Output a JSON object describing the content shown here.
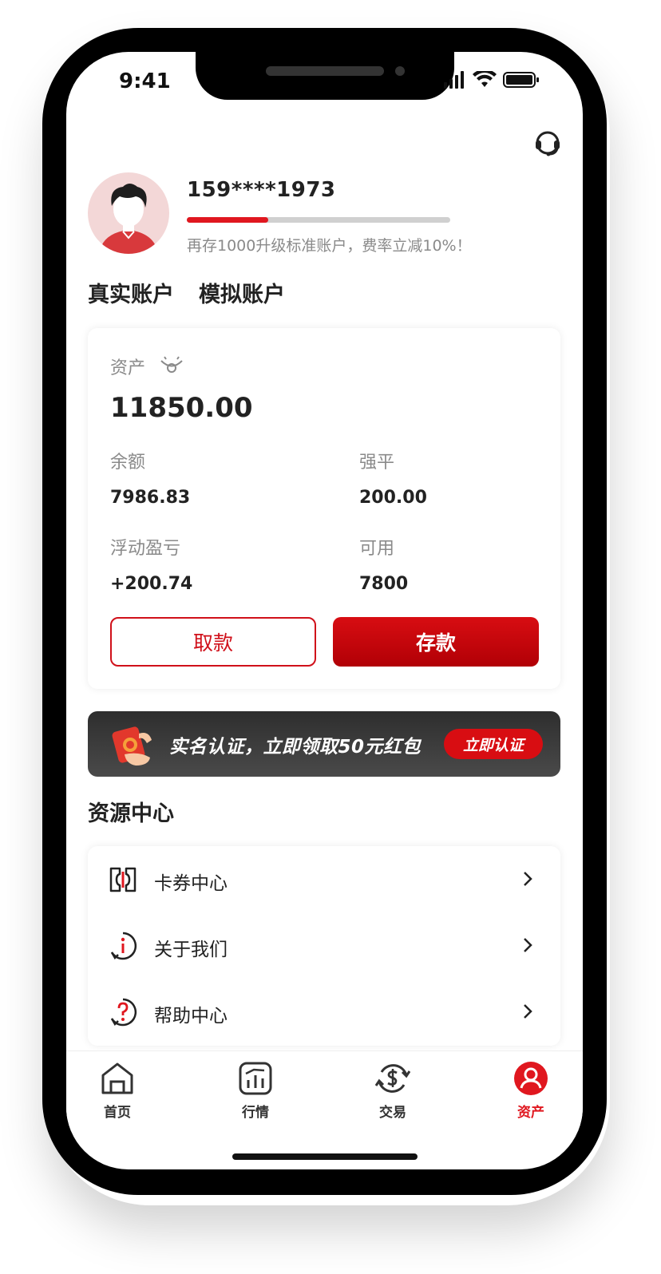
{
  "status_bar": {
    "time": "9:41"
  },
  "profile": {
    "phone": "159****1973",
    "progress": 0.31,
    "upgrade_text": "再存1000升级标准账户，费率立减10%！"
  },
  "account_tabs": [
    {
      "label": "真实账户",
      "active": true
    },
    {
      "label": "模拟账户",
      "active": false
    }
  ],
  "asset_card": {
    "asset_label": "资产",
    "asset_value": "11850.00",
    "stats": [
      {
        "label": "余额",
        "value": "7986.83"
      },
      {
        "label": "强平",
        "value": "200.00"
      },
      {
        "label": "浮动盈亏",
        "value": "+200.74"
      },
      {
        "label": "可用",
        "value": "7800"
      }
    ],
    "withdraw_label": "取款",
    "deposit_label": "存款"
  },
  "banner": {
    "text": "实名认证，立即领取50元红包",
    "button_label": "立即认证"
  },
  "resources": {
    "title": "资源中心",
    "items": [
      {
        "label": "卡券中心",
        "icon": "coupon-icon"
      },
      {
        "label": "关于我们",
        "icon": "info-icon"
      },
      {
        "label": "帮助中心",
        "icon": "help-icon"
      }
    ]
  },
  "tabbar": {
    "items": [
      {
        "label": "首页",
        "icon": "home-icon",
        "active": false
      },
      {
        "label": "行情",
        "icon": "market-icon",
        "active": false
      },
      {
        "label": "交易",
        "icon": "trade-icon",
        "active": false
      },
      {
        "label": "资产",
        "icon": "asset-icon",
        "active": true
      }
    ]
  },
  "colors": {
    "accent": "#e0171f",
    "deposit_button": "#c80a10",
    "banner_bg": "#3a3a3a"
  }
}
